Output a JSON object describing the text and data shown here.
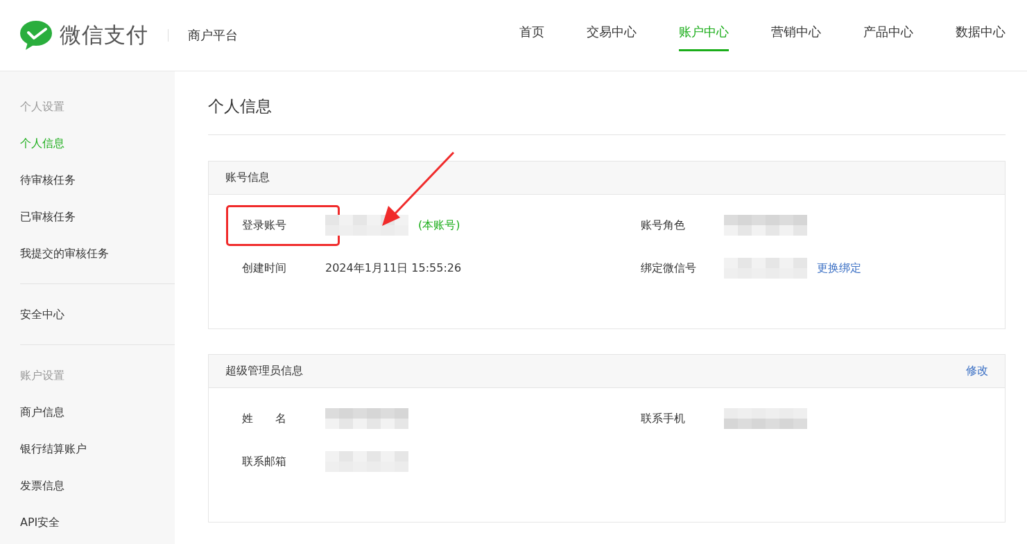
{
  "header": {
    "brand": "微信支付",
    "subtitle": "商户平台",
    "nav": [
      {
        "label": "首页",
        "selected": false
      },
      {
        "label": "交易中心",
        "selected": false
      },
      {
        "label": "账户中心",
        "selected": true
      },
      {
        "label": "营销中心",
        "selected": false
      },
      {
        "label": "产品中心",
        "selected": false
      },
      {
        "label": "数据中心",
        "selected": false
      }
    ]
  },
  "sidebar": {
    "groups": [
      {
        "heading": "个人设置",
        "items": [
          {
            "label": "个人信息",
            "selected": true
          },
          {
            "label": "待审核任务",
            "selected": false
          },
          {
            "label": "已审核任务",
            "selected": false
          },
          {
            "label": "我提交的审核任务",
            "selected": false
          }
        ]
      },
      {
        "items": [
          {
            "label": "安全中心",
            "selected": false
          }
        ]
      },
      {
        "heading": "账户设置",
        "items": [
          {
            "label": "商户信息",
            "selected": false
          },
          {
            "label": "银行结算账户",
            "selected": false
          },
          {
            "label": "发票信息",
            "selected": false
          },
          {
            "label": "API安全",
            "selected": false
          }
        ]
      }
    ]
  },
  "page_title": "个人信息",
  "panels": [
    {
      "title": "账号信息",
      "fields": [
        {
          "label": "登录账号",
          "redacted": true,
          "highlighted": true,
          "tag": "(本账号)"
        },
        {
          "label": "账号角色",
          "redacted": true
        },
        {
          "label": "创建时间",
          "value": "2024年1月11日 15:55:26"
        },
        {
          "label": "绑定微信号",
          "redacted": true,
          "link": "更换绑定"
        }
      ]
    },
    {
      "title": "超级管理员信息",
      "action": "修改",
      "fields": [
        {
          "label": "姓　　名",
          "redacted": true
        },
        {
          "label": "联系手机",
          "redacted": true
        },
        {
          "label": "联系邮箱",
          "redacted": true
        }
      ]
    }
  ],
  "annotations": [
    {
      "kind": "arrow"
    }
  ]
}
